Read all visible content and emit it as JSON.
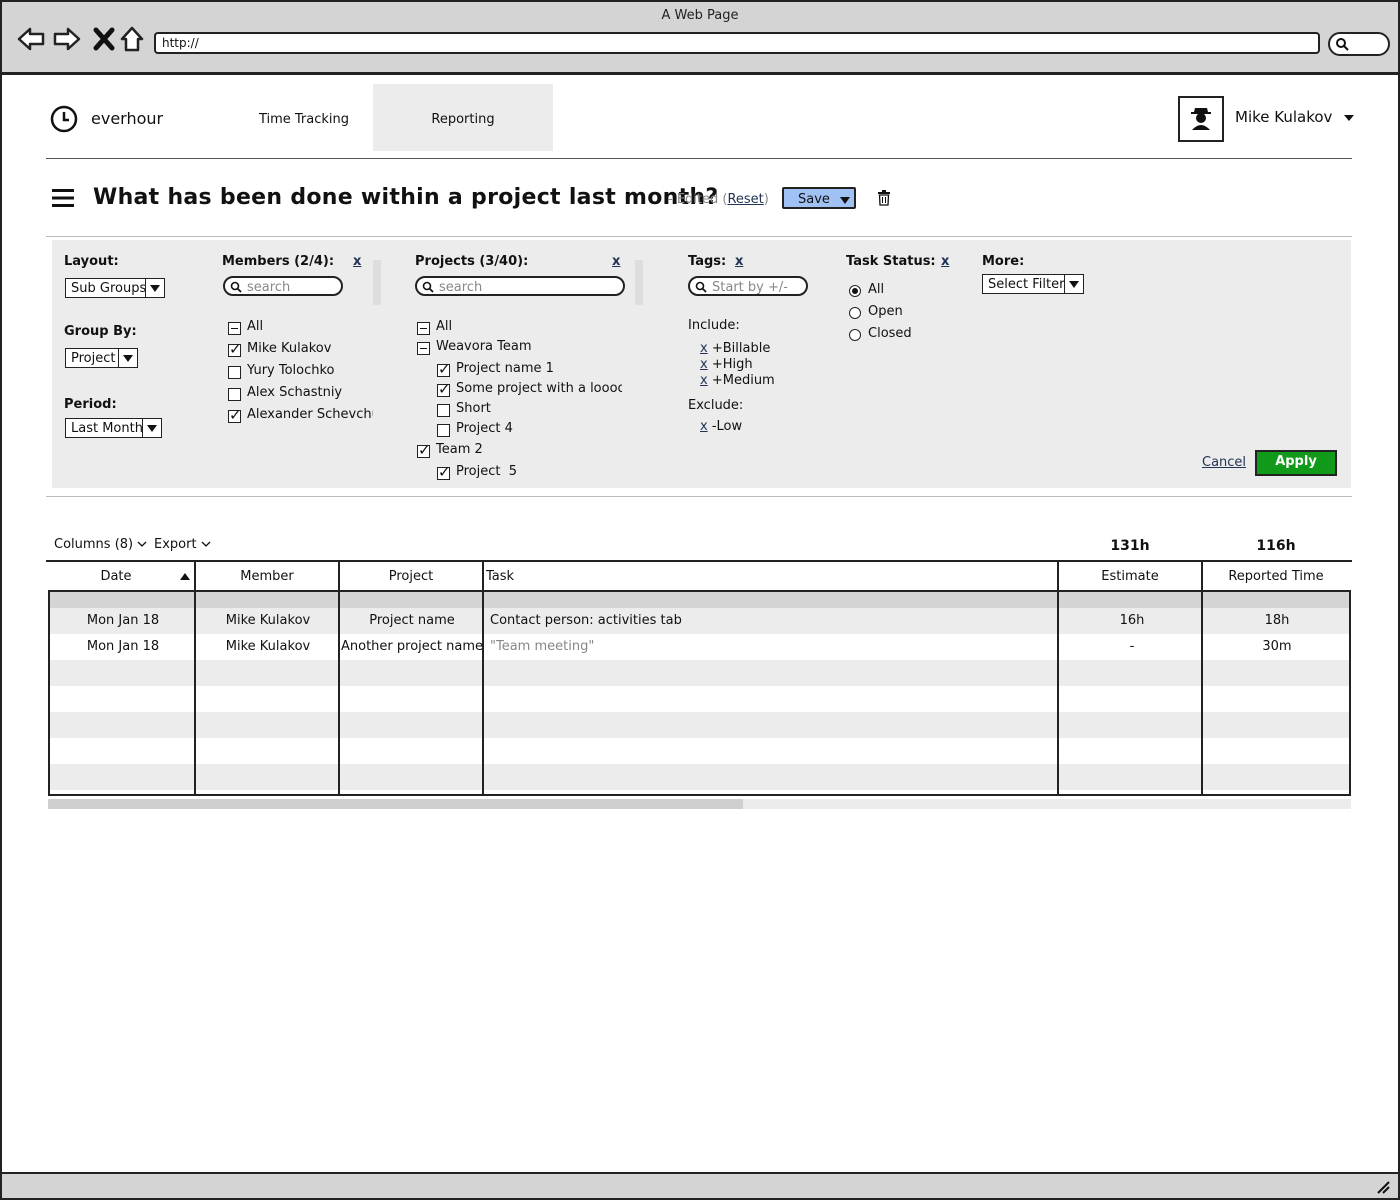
{
  "browser": {
    "window_title": "A Web Page",
    "url": "http://"
  },
  "header": {
    "logo": "everhour",
    "nav_tabs": [
      {
        "label": "Time Tracking"
      },
      {
        "label": "Reporting",
        "active": true
      }
    ],
    "user_name": "Mike Kulakov"
  },
  "report": {
    "title": "What has been done within a project last month?",
    "edited_prefix": "- Edited (",
    "reset_label": "Reset",
    "edited_suffix": ")",
    "save_label": "Save"
  },
  "filters": {
    "layout": {
      "label": "Layout:",
      "value": "Sub Groups"
    },
    "group_by": {
      "label": "Group By:",
      "value": "Project"
    },
    "period": {
      "label": "Period:",
      "value": "Last Month"
    },
    "members": {
      "label": "Members (2/4):",
      "clear": "x",
      "search_placeholder": "search",
      "items": [
        {
          "label": "All",
          "state": "partial"
        },
        {
          "label": "Mike Kulakov",
          "state": "checked"
        },
        {
          "label": "Yury Tolochko",
          "state": "unchecked"
        },
        {
          "label": "Alex Schastniy",
          "state": "unchecked"
        },
        {
          "label": "Alexander Schevchuk",
          "state": "checked"
        }
      ]
    },
    "projects": {
      "label": "Projects (3/40):",
      "clear": "x",
      "search_placeholder": "search",
      "items": [
        {
          "label": "All",
          "state": "partial"
        },
        {
          "label": "Weavora Team",
          "state": "partial"
        },
        {
          "label": "Project name 1",
          "state": "checked"
        },
        {
          "label": "Some project with a loooooong",
          "state": "checked"
        },
        {
          "label": "Short",
          "state": "unchecked"
        },
        {
          "label": "Project 4",
          "state": "unchecked"
        },
        {
          "label": "Team 2",
          "state": "checked"
        },
        {
          "label": "Project  5",
          "state": "checked"
        }
      ]
    },
    "tags": {
      "label": "Tags:",
      "clear": "x",
      "search_placeholder": "Start by +/-",
      "include_label": "Include:",
      "include": [
        "+Billable",
        "+High",
        "+Medium"
      ],
      "exclude_label": "Exclude:",
      "exclude": [
        "-Low"
      ],
      "remove": "x"
    },
    "task_status": {
      "label": "Task Status:",
      "clear": "x",
      "options": [
        {
          "label": "All",
          "selected": true
        },
        {
          "label": "Open",
          "selected": false
        },
        {
          "label": "Closed",
          "selected": false
        }
      ]
    },
    "more": {
      "label": "More:",
      "value": "Select Filter"
    },
    "cancel_label": "Cancel",
    "apply_label": "Apply"
  },
  "table": {
    "columns_menu": "Columns (8)",
    "export_menu": "Export",
    "totals": {
      "estimate": "131h",
      "reported": "116h"
    },
    "headers": [
      "Date",
      "Member",
      "Project",
      "Task",
      "Estimate",
      "Reported Time"
    ],
    "rows": [
      {
        "date": "Mon Jan 18",
        "member": "Mike Kulakov",
        "project": "Project name",
        "task": "Contact person: activities tab",
        "estimate": "16h",
        "reported": "18h"
      },
      {
        "date": "Mon Jan 18",
        "member": "Mike Kulakov",
        "project": "Another project name",
        "task": "\"Team meeting\"",
        "estimate": "-",
        "reported": "30m"
      }
    ]
  }
}
